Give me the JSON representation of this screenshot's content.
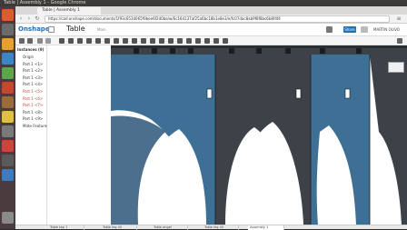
{
  "os": {
    "topbar_title": "Table | Assembly 1 - Google Chrome"
  },
  "browser": {
    "tab_title": "Table | Assembly 1",
    "url": "https://cad.onshape.com/documents/1f93c6534065f9bee6f2d0be/w/6c16d137af25a6bc18b1e8e3/e/fc07dac8ab9f8f8bc6b8f4f4"
  },
  "onshape": {
    "logo": "Onshape",
    "doc_title": "Table",
    "doc_sub": "Main",
    "share_label": "Share",
    "user": "MARTIN OLIVO"
  },
  "panel": {
    "title": "Instances (9)",
    "items": [
      {
        "label": "Origin",
        "red": false
      },
      {
        "label": "Part 1 <1>",
        "red": false
      },
      {
        "label": "Part 1 <2>",
        "red": false
      },
      {
        "label": "Part 1 <3>",
        "red": false
      },
      {
        "label": "Part 1 <4>",
        "red": false
      },
      {
        "label": "Part 1 <5>",
        "red": true
      },
      {
        "label": "Part 1 <6>",
        "red": true
      },
      {
        "label": "Part 1 <7>",
        "red": true
      },
      {
        "label": "Part 1 <8>",
        "red": false
      },
      {
        "label": "Part 1 <9>",
        "red": false
      },
      {
        "label": "Mate Features (8)",
        "red": false
      }
    ]
  },
  "taskbar": {
    "tabs": [
      "Table top 1",
      "Table leg 40",
      "Table angel",
      "Table leg 40",
      "Assembly 1"
    ]
  },
  "colors": {
    "part_blue": "#3e6f95",
    "part_dark": "#3d4249",
    "part_edge": "#1a1d22"
  }
}
